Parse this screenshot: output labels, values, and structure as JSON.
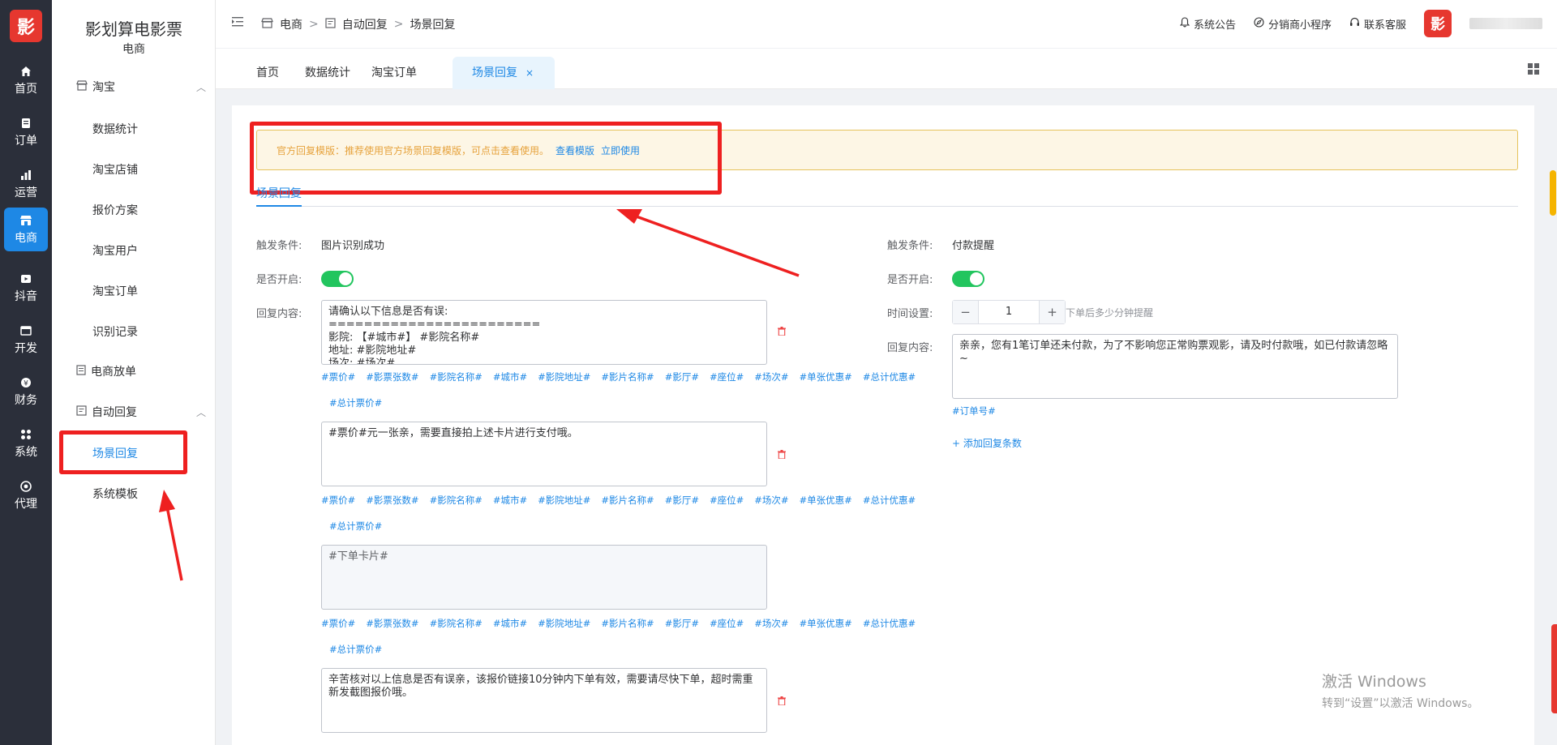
{
  "rail": {
    "logo": "影",
    "items": [
      {
        "label": "首页",
        "icon": "home-icon"
      },
      {
        "label": "订单",
        "icon": "order-icon"
      },
      {
        "label": "运营",
        "icon": "chart-icon"
      },
      {
        "label": "电商",
        "icon": "store-icon"
      },
      {
        "label": "抖音",
        "icon": "video-icon"
      },
      {
        "label": "开发",
        "icon": "code-icon"
      },
      {
        "label": "财务",
        "icon": "yen-icon"
      },
      {
        "label": "系统",
        "icon": "apps-icon"
      },
      {
        "label": "代理",
        "icon": "agent-icon"
      }
    ]
  },
  "menu": {
    "title": "影划算电影票",
    "subtitle": "电商",
    "group_taobao": "淘宝",
    "taobao_items": [
      "数据统计",
      "淘宝店铺",
      "报价方案",
      "淘宝用户",
      "淘宝订单",
      "识别记录"
    ],
    "ecom_order": "电商放单",
    "group_auto": "自动回复",
    "auto_items": [
      "场景回复",
      "系统模板"
    ]
  },
  "header": {
    "crumbs": [
      "电商",
      "自动回复",
      "场景回复"
    ],
    "notice": "系统公告",
    "miniapp": "分销商小程序",
    "support": "联系客服",
    "avatar": "影"
  },
  "tabs": {
    "items": [
      "首页",
      "数据统计",
      "淘宝订单",
      "场景回复"
    ],
    "close": "×"
  },
  "notice": {
    "text": "官方回复模版：推荐使用官方场景回复模版，可点击查看使用。",
    "view": "查看模版",
    "use": "立即使用"
  },
  "subtab": "场景回复",
  "left": {
    "trigger_label": "触发条件:",
    "trigger_value": "图片识别成功",
    "enable_label": "是否开启:",
    "reply_label": "回复内容:",
    "reply1": "请确认以下信息是否有误:\n========================\n影院: 【#城市#】 #影院名称#\n地址: #影院地址#\n场次: #场次#",
    "reply2": "#票价#元一张亲，需要直接拍上述卡片进行支付哦。",
    "reply3": "#下单卡片#",
    "reply4": "辛苦核对以上信息是否有误亲，该报价链接10分钟内下单有效，需要请尽快下单，超时需重新发截图报价哦。",
    "tags": [
      "#票价#",
      "#影票张数#",
      "#影院名称#",
      "#城市#",
      "#影院地址#",
      "#影片名称#",
      "#影厅#",
      "#座位#",
      "#场次#",
      "#单张优惠#",
      "#总计优惠#"
    ],
    "tag_extra": "#总计票价#"
  },
  "right": {
    "trigger_label": "触发条件:",
    "trigger_value": "付款提醒",
    "enable_label": "是否开启:",
    "time_label": "时间设置:",
    "time_value": "1",
    "time_hint": "下单后多少分钟提醒",
    "reply_label": "回复内容:",
    "reply": "亲亲，您有1笔订单还未付款，为了不影响您正常购票观影，请及时付款哦，如已付款请忽略~",
    "tag": "#订单号#",
    "add": "+ 添加回复条数",
    "minus": "−",
    "plus": "+"
  },
  "watermark": {
    "line1": "激活 Windows",
    "line2": "转到“设置”以激活 Windows。"
  }
}
